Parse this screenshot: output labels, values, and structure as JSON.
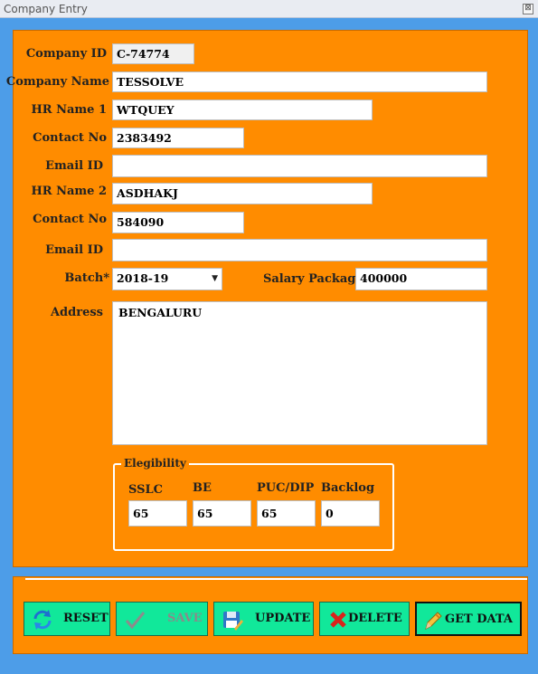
{
  "window": {
    "title": "Company Entry",
    "close_glyph": "⊠"
  },
  "form": {
    "company_id_label": "Company ID",
    "company_id_value": "C-74774",
    "company_name_label": "Company Name",
    "company_name_value": "TESSOLVE",
    "hr1_label": "HR Name 1",
    "hr1_value": "WTQUEY",
    "contact1_label": "Contact No",
    "contact1_value": "2383492",
    "email1_label": "Email ID",
    "email1_value": "",
    "hr2_label": "HR Name 2",
    "hr2_value": "ASDHAKJ",
    "contact2_label": "Contact No",
    "contact2_value": "584090",
    "email2_label": "Email ID",
    "email2_value": "",
    "batch_label": "Batch*",
    "batch_value": "2018-19",
    "salary_label": "Salary Package",
    "salary_value": "400000",
    "address_label": "Address",
    "address_value": "BENGALURU"
  },
  "eligibility": {
    "legend": "Elegibility",
    "sslc_label": "SSLC",
    "sslc_value": "65",
    "be_label": "BE",
    "be_value": "65",
    "puc_label": "PUC/DIP",
    "puc_value": "65",
    "backlog_label": "Backlog",
    "backlog_value": "0"
  },
  "buttons": {
    "reset": "RESET",
    "save": "SAVE",
    "update": "UPDATE",
    "delete": "DELETE",
    "get_data": "GET DATA"
  },
  "colors": {
    "panel": "#ff8c00",
    "background": "#4d9de8",
    "button": "#11e89a"
  }
}
